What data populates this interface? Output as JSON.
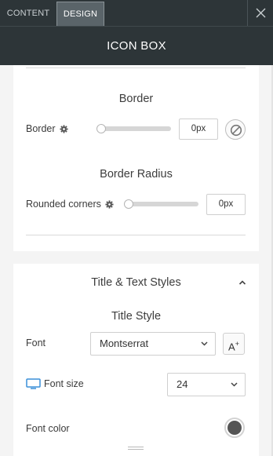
{
  "tabs": [
    {
      "label": "CONTENT",
      "active": false
    },
    {
      "label": "DESIGN",
      "active": true
    }
  ],
  "header": {
    "title": "ICON BOX"
  },
  "border_section": {
    "title": "Border",
    "border": {
      "label": "Border",
      "value": "0px",
      "slider_fraction": 0
    }
  },
  "radius_section": {
    "title": "Border Radius",
    "rounded": {
      "label": "Rounded corners",
      "value": "0px",
      "slider_fraction": 0
    }
  },
  "title_text_section": {
    "title": "Title & Text Styles",
    "subtitle": "Title Style",
    "font": {
      "label": "Font",
      "value": "Montserrat"
    },
    "font_button": {
      "label": "A",
      "sup": "+"
    },
    "font_size": {
      "label": "Font size",
      "value": "24"
    },
    "font_color": {
      "label": "Font color",
      "color": "#555555"
    }
  },
  "colors": {
    "topbar": "#2d3538",
    "accent_tab": "#5a6469"
  },
  "icons": [
    "close-icon",
    "gear-icon",
    "no-entry-icon",
    "chevron-up-icon",
    "chevron-down-icon",
    "monitor-icon"
  ]
}
